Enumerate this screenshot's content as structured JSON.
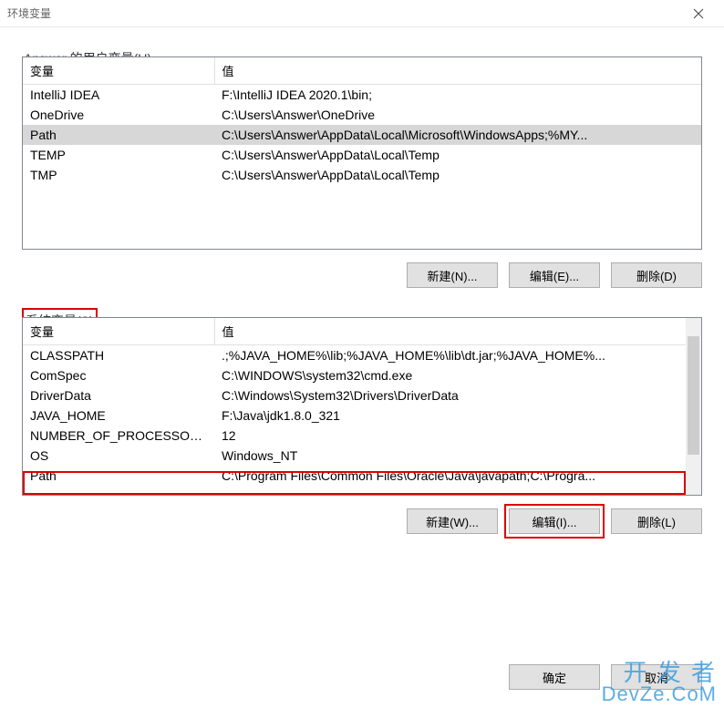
{
  "window": {
    "title": "环境变量"
  },
  "userVars": {
    "label": "Answer 的用户变量(U)",
    "headers": {
      "var": "变量",
      "val": "值"
    },
    "rows": [
      {
        "var": "IntelliJ IDEA",
        "val": "F:\\IntelliJ IDEA 2020.1\\bin;"
      },
      {
        "var": "OneDrive",
        "val": "C:\\Users\\Answer\\OneDrive"
      },
      {
        "var": "Path",
        "val": "C:\\Users\\Answer\\AppData\\Local\\Microsoft\\WindowsApps;%MY..."
      },
      {
        "var": "TEMP",
        "val": "C:\\Users\\Answer\\AppData\\Local\\Temp"
      },
      {
        "var": "TMP",
        "val": "C:\\Users\\Answer\\AppData\\Local\\Temp"
      }
    ],
    "buttons": {
      "new": "新建(N)...",
      "edit": "编辑(E)...",
      "delete": "删除(D)"
    }
  },
  "sysVars": {
    "label": "系统变量(S)",
    "headers": {
      "var": "变量",
      "val": "值"
    },
    "rows": [
      {
        "var": "CLASSPATH",
        "val": ".;%JAVA_HOME%\\lib;%JAVA_HOME%\\lib\\dt.jar;%JAVA_HOME%..."
      },
      {
        "var": "ComSpec",
        "val": "C:\\WINDOWS\\system32\\cmd.exe"
      },
      {
        "var": "DriverData",
        "val": "C:\\Windows\\System32\\Drivers\\DriverData"
      },
      {
        "var": "JAVA_HOME",
        "val": "F:\\Java\\jdk1.8.0_321"
      },
      {
        "var": "NUMBER_OF_PROCESSORS",
        "val": "12"
      },
      {
        "var": "OS",
        "val": "Windows_NT"
      },
      {
        "var": "Path",
        "val": "C:\\Program Files\\Common Files\\Oracle\\Java\\javapath;C:\\Progra..."
      }
    ],
    "buttons": {
      "new": "新建(W)...",
      "edit": "编辑(I)...",
      "delete": "删除(L)"
    }
  },
  "dialog": {
    "ok": "确定",
    "cancel": "取消"
  },
  "watermark": {
    "line1": "开 发 者",
    "line2": "DevZe.CoM"
  }
}
